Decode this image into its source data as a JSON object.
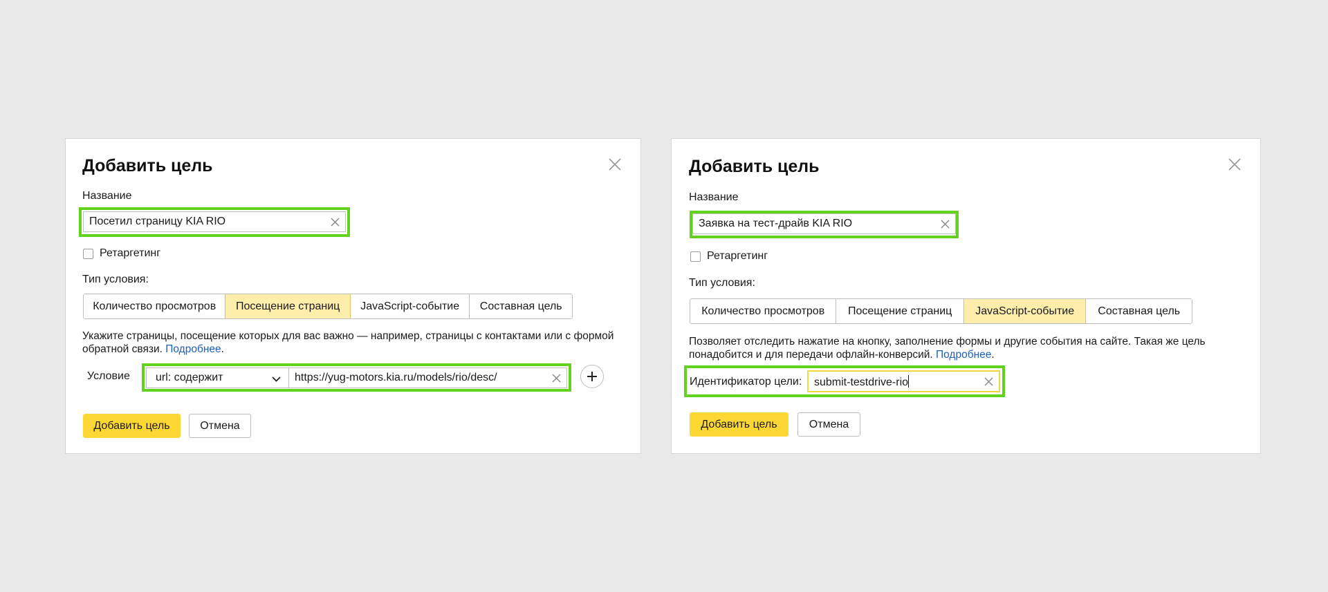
{
  "dialog1": {
    "title": "Добавить цель",
    "name_label": "Название",
    "name_value": "Посетил страницу KIA RIO",
    "retargeting_label": "Ретаргетинг",
    "condition_type_label": "Тип условия:",
    "tabs": [
      "Количество просмотров",
      "Посещение страниц",
      "JavaScript-событие",
      "Составная цель"
    ],
    "active_tab": "Посещение страниц",
    "description": "Укажите страницы, посещение которых для вас важно — например, страницы с контактами или с формой обратной связи.",
    "more_link": "Подробнее",
    "condition_label": "Условие",
    "condition_select": "url: содержит",
    "condition_url": "https://yug-motors.kia.ru/models/rio/desc/",
    "add_button": "Добавить цель",
    "cancel_button": "Отмена"
  },
  "dialog2": {
    "title": "Добавить цель",
    "name_label": "Название",
    "name_value": "Заявка на тест-драйв KIA RIO",
    "retargeting_label": "Ретаргетинг",
    "condition_type_label": "Тип условия:",
    "tabs": [
      "Количество просмотров",
      "Посещение страниц",
      "JavaScript-событие",
      "Составная цель"
    ],
    "active_tab": "JavaScript-событие",
    "description": "Позволяет отследить нажатие на кнопку, заполнение формы и другие события на сайте. Такая же цель понадобится и для передачи офлайн-конверсий.",
    "more_link": "Подробнее",
    "goal_id_label": "Идентификатор цели:",
    "goal_id_value": "submit-testdrive-rio",
    "add_button": "Добавить цель",
    "cancel_button": "Отмена"
  },
  "colors": {
    "background": "#e9e9e9",
    "highlight": "#63d21e",
    "active_tab": "#fdeeac",
    "primary_button": "#fdd835",
    "link": "#1a5fc2"
  }
}
